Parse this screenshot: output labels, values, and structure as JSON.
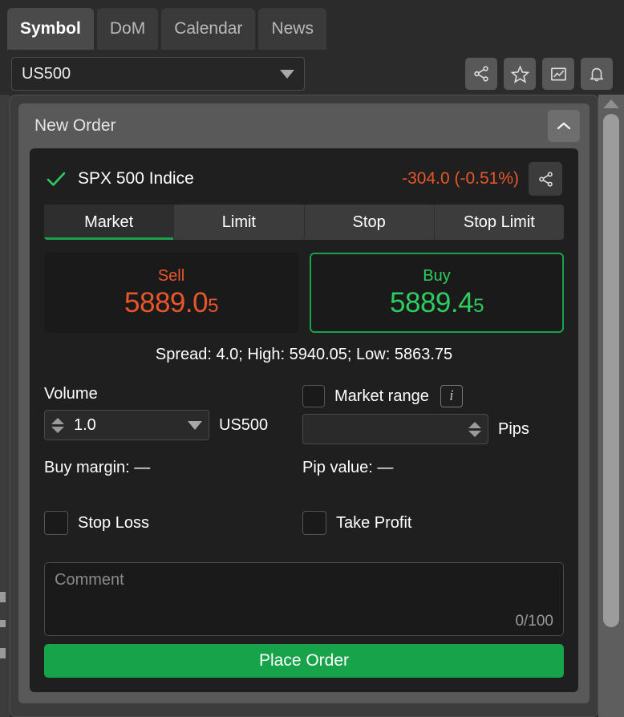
{
  "tabs": [
    {
      "label": "Symbol",
      "active": true
    },
    {
      "label": "DoM",
      "active": false
    },
    {
      "label": "Calendar",
      "active": false
    },
    {
      "label": "News",
      "active": false
    }
  ],
  "symbol_select": {
    "value": "US500",
    "caret": "chevron-down-icon"
  },
  "toolbar_icons": [
    {
      "name": "share-icon"
    },
    {
      "name": "star-icon"
    },
    {
      "name": "chart-icon"
    },
    {
      "name": "bell-icon"
    }
  ],
  "panel": {
    "title": "New Order",
    "collapse_icon": "chevron-up-icon"
  },
  "instrument": {
    "check_icon": "check-icon",
    "name": "SPX 500 Indice",
    "change": "-304.0 (-0.51%)",
    "change_color": "#e8562a",
    "share_icon": "share-icon"
  },
  "order_types": [
    {
      "label": "Market",
      "active": true
    },
    {
      "label": "Limit",
      "active": false
    },
    {
      "label": "Stop",
      "active": false
    },
    {
      "label": "Stop Limit",
      "active": false
    }
  ],
  "quotes": {
    "sell": {
      "label": "Sell",
      "price_main": "5889.0",
      "price_last": "5",
      "color": "#e8562a"
    },
    "buy": {
      "label": "Buy",
      "price_main": "5889.4",
      "price_last": "5",
      "color": "#2ecc5f",
      "selected": true
    },
    "stats": "Spread: 4.0; High: 5940.05; Low: 5863.75"
  },
  "volume": {
    "label": "Volume",
    "value": "1.0",
    "unit": "US500",
    "margin_text": "Buy margin: —"
  },
  "market_range": {
    "label": "Market range",
    "checked": false,
    "info_icon": "info-icon",
    "info_glyph": "i",
    "value": "",
    "unit": "Pips",
    "pip_value_text": "Pip value: —"
  },
  "stop_loss": {
    "label": "Stop Loss",
    "checked": false
  },
  "take_profit": {
    "label": "Take Profit",
    "checked": false
  },
  "comment": {
    "placeholder": "Comment",
    "value": "",
    "counter": "0/100"
  },
  "place_order": {
    "label": "Place Order",
    "color": "#16a34a"
  },
  "scrollbar": {
    "up_arrow": "triangle-up-icon"
  }
}
